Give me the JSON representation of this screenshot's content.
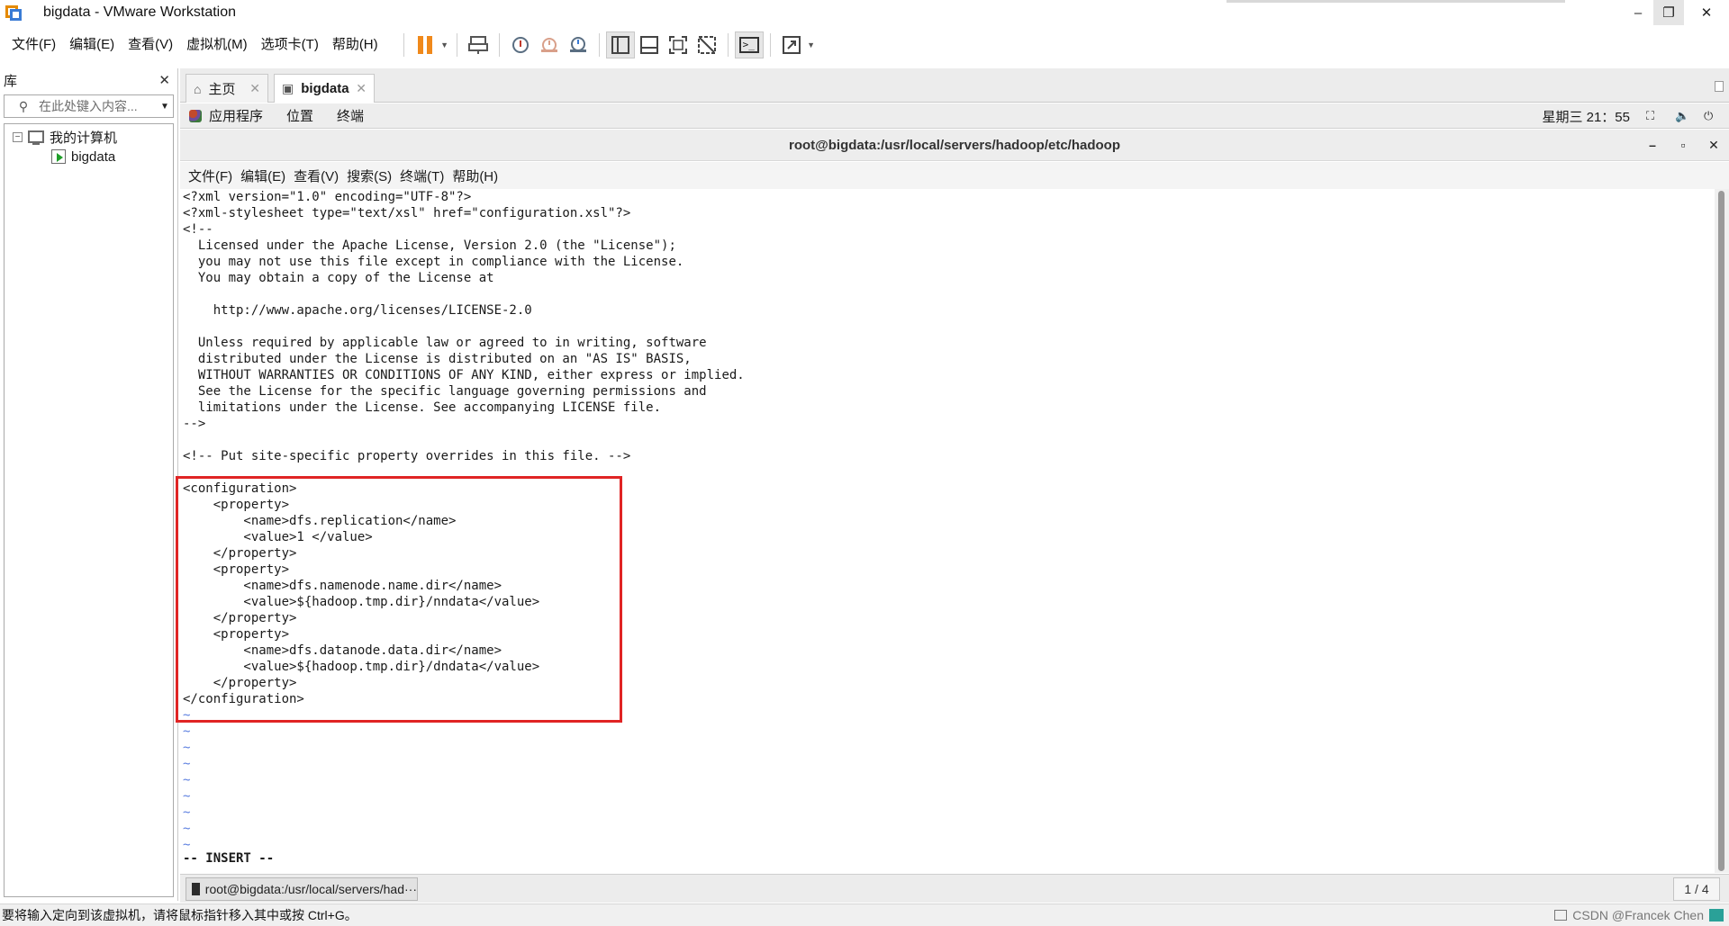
{
  "window": {
    "title": "bigdata - VMware Workstation",
    "controls": [
      "–",
      "❐",
      "✕"
    ]
  },
  "menubar": [
    {
      "label": "文件(F)"
    },
    {
      "label": "编辑(E)"
    },
    {
      "label": "查看(V)"
    },
    {
      "label": "虚拟机(M)"
    },
    {
      "label": "选项卡(T)"
    },
    {
      "label": "帮助(H)"
    }
  ],
  "toolbar": {
    "icons": [
      "pause-icon",
      "send-keys-icon",
      "snapshot-icon",
      "revert-snapshot-icon",
      "snapshot-manager-icon",
      "sidebar-view-icon",
      "thumbnail-view-icon",
      "fullscreen-icon",
      "unity-icon",
      "console-icon",
      "stretch-icon"
    ],
    "accent": "#f0891b"
  },
  "library": {
    "title": "库",
    "close": "✕",
    "search_placeholder": "在此处键入内容...",
    "tree": {
      "root": "我的计算机",
      "children": [
        "bigdata"
      ]
    }
  },
  "tabs": [
    {
      "label": "主页",
      "icon": "home-icon"
    },
    {
      "label": "bigdata",
      "icon": "vm-icon",
      "active": true
    }
  ],
  "guest_topbar": {
    "items": [
      "应用程序",
      "位置",
      "终端"
    ],
    "clock": "星期三 21：55"
  },
  "terminal": {
    "title": "root@bigdata:/usr/local/servers/hadoop/etc/hadoop",
    "menu": [
      "文件(F)",
      "编辑(E)",
      "查看(V)",
      "搜索(S)",
      "终端(T)",
      "帮助(H)"
    ],
    "lines": [
      "<?xml version=\"1.0\" encoding=\"UTF-8\"?>",
      "<?xml-stylesheet type=\"text/xsl\" href=\"configuration.xsl\"?>",
      "<!--",
      "  Licensed under the Apache License, Version 2.0 (the \"License\");",
      "  you may not use this file except in compliance with the License.",
      "  You may obtain a copy of the License at",
      "",
      "    http://www.apache.org/licenses/LICENSE-2.0",
      "",
      "  Unless required by applicable law or agreed to in writing, software",
      "  distributed under the License is distributed on an \"AS IS\" BASIS,",
      "  WITHOUT WARRANTIES OR CONDITIONS OF ANY KIND, either express or implied.",
      "  See the License for the specific language governing permissions and",
      "  limitations under the License. See accompanying LICENSE file.",
      "-->",
      "",
      "<!-- Put site-specific property overrides in this file. -->",
      "",
      "<configuration>",
      "    <property>",
      "        <name>dfs.replication</name>",
      "        <value>1 </value>",
      "    </property>",
      "    <property>",
      "        <name>dfs.namenode.name.dir</name>",
      "        <value>${hadoop.tmp.dir}/nndata</value>",
      "    </property>",
      "    <property>",
      "        <name>dfs.datanode.data.dir</name>",
      "        <value>${hadoop.tmp.dir}/dndata</value>",
      "    </property>",
      "</configuration>"
    ],
    "tildes": [
      "~",
      "~",
      "~",
      "~",
      "~",
      "~",
      "~",
      "~",
      "~"
    ],
    "mode": "-- INSERT --",
    "highlight_color": "#e02424"
  },
  "taskbar": {
    "item": "root@bigdata:/usr/local/servers/had···",
    "pager": "1 / 4"
  },
  "statusbar": {
    "message": "要将输入定向到该虚拟机，请将鼠标指针移入其中或按 Ctrl+G。",
    "watermark": "CSDN @Francek Chen"
  }
}
